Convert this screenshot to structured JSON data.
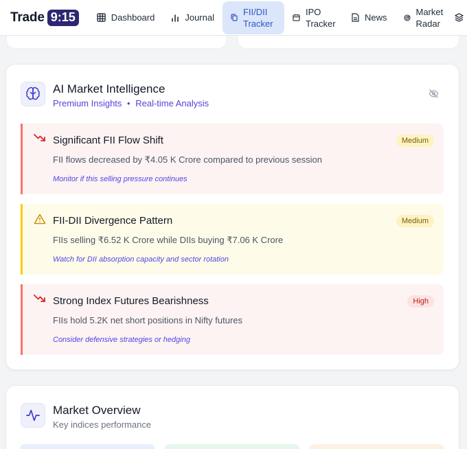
{
  "brand": {
    "name": "Trade",
    "badge": "9:15"
  },
  "nav": {
    "items": [
      {
        "label": "Dashboard",
        "icon": "grid-icon",
        "active": false
      },
      {
        "label": "Journal",
        "icon": "bar-chart-icon",
        "active": false
      },
      {
        "label": "FII/DII Tracker",
        "icon": "copy-icon",
        "active": true
      },
      {
        "label": "IPO Tracker",
        "icon": "calendar-icon",
        "active": false
      },
      {
        "label": "News",
        "icon": "document-icon",
        "active": false
      },
      {
        "label": "Market Radar",
        "icon": "radar-icon",
        "active": false
      },
      {
        "label": "",
        "icon": "layers-icon",
        "active": false
      }
    ]
  },
  "ai_card": {
    "title": "AI Market Intelligence",
    "subtitle_left": "Premium Insights",
    "subtitle_sep": "•",
    "subtitle_right": "Real-time Analysis",
    "icon": "brain-icon",
    "toggle_icon": "eye-off-icon",
    "alerts": [
      {
        "icon": "trending-down-icon",
        "title": "Significant FII Flow Shift",
        "description": "FII flows decreased by ₹4.05 K Crore compared to previous session",
        "hint": "Monitor if this selling pressure continues",
        "severity": "Medium",
        "color": "#f87171"
      },
      {
        "icon": "warning-icon",
        "title": "FII-DII Divergence Pattern",
        "description": "FIIs selling ₹6.52 K Crore while DIIs buying ₹7.06 K Crore",
        "hint": "Watch for DII absorption capacity and sector rotation",
        "severity": "Medium",
        "color": "#facc15"
      },
      {
        "icon": "trending-down-icon",
        "title": "Strong Index Futures Bearishness",
        "description": "FIIs hold 5.2K net short positions in Nifty futures",
        "hint": "Consider defensive strategies or hedging",
        "severity": "High",
        "color": "#f87171"
      }
    ]
  },
  "overview_card": {
    "title": "Market Overview",
    "subtitle": "Key indices performance",
    "icon": "activity-icon"
  }
}
